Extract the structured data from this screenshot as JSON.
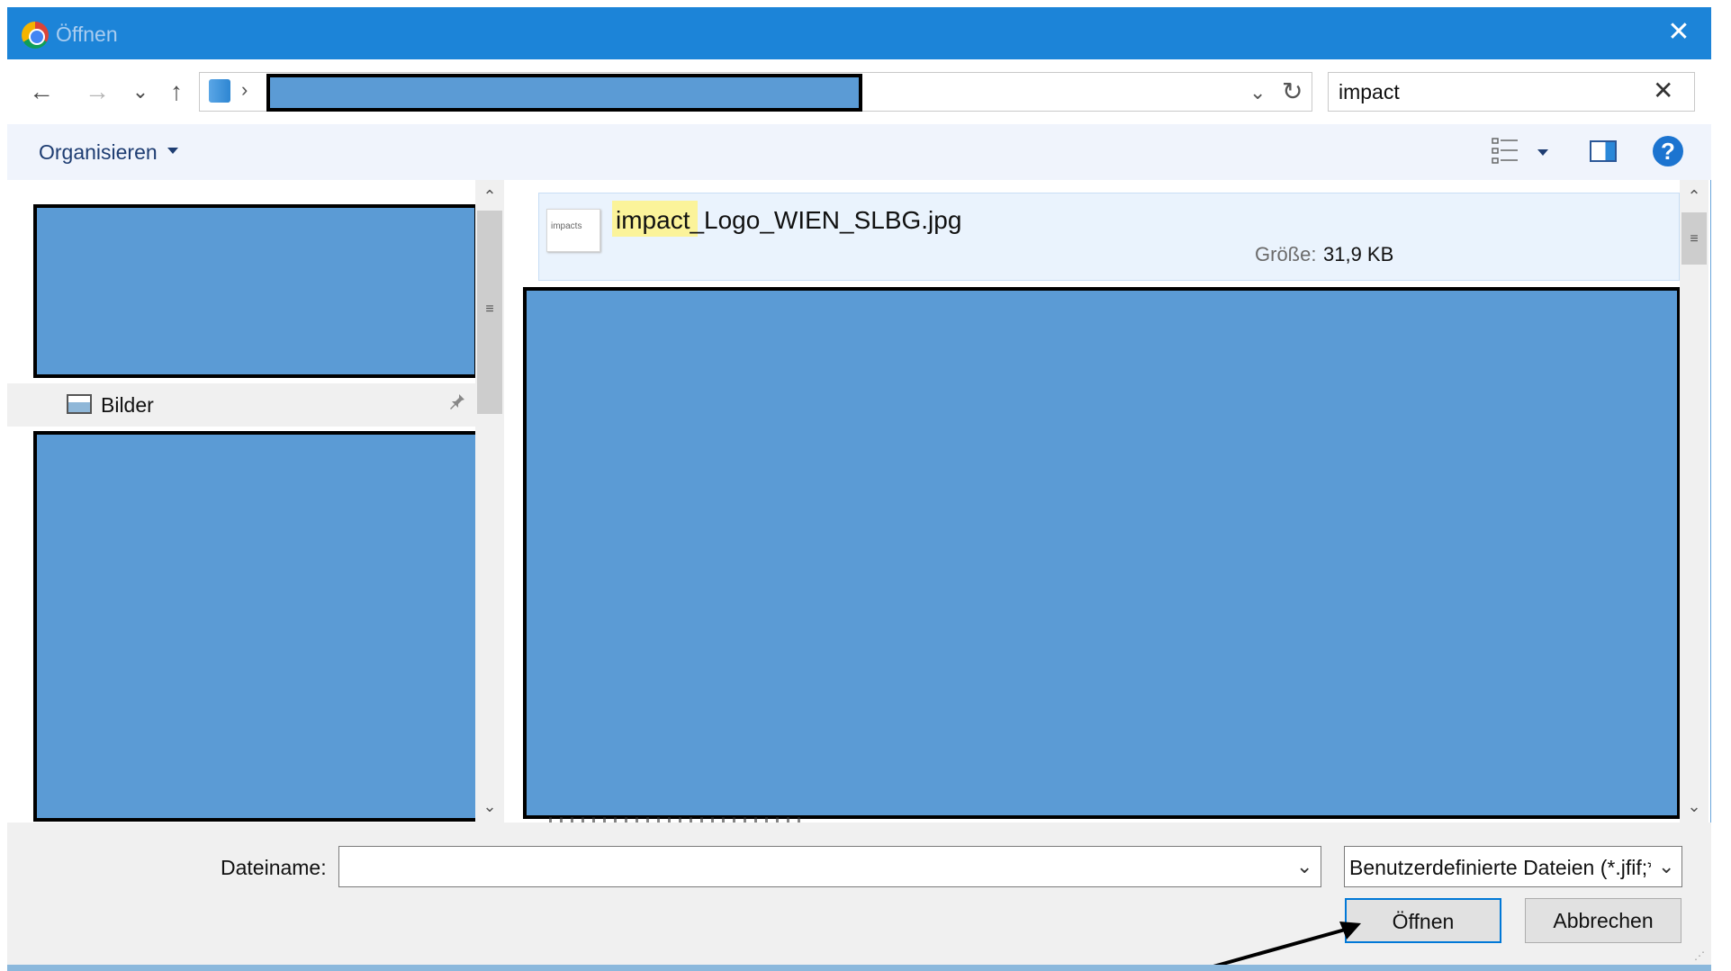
{
  "window": {
    "title": "Öffnen",
    "close_glyph": "✕"
  },
  "nav": {
    "back_glyph": "←",
    "forward_glyph": "→",
    "recent_glyph": "⌄",
    "up_glyph": "↑",
    "path_sep": "›",
    "address_dd_glyph": "⌄",
    "refresh_glyph": "↻"
  },
  "search": {
    "value": "impact",
    "clear_glyph": "✕"
  },
  "toolbar": {
    "organize_label": "Organisieren",
    "help_glyph": "?"
  },
  "sidebar": {
    "items": [
      {
        "label": "Bilder",
        "icon": "pictures-icon",
        "pinned": true
      }
    ],
    "pin_glyph": "📌"
  },
  "files": [
    {
      "name_highlight": "impact",
      "name_rest": "_Logo_WIEN_SLBG.jpg",
      "size_label": "Größe:",
      "size_value": "31,9 KB",
      "thumb_text": "impacts"
    }
  ],
  "scroll": {
    "up_glyph": "⌃",
    "down_glyph": "⌄",
    "grip_glyph": "≡"
  },
  "footer": {
    "filename_label": "Dateiname:",
    "filename_value": "",
    "filetype_value": "Benutzerdefinierte Dateien (*.jfif;*.pjpeg;*.jpeg;*.pjp;*.jpg;*.png)",
    "dd_glyph": "⌄",
    "open_label": "Öffnen",
    "cancel_label": "Abbrechen"
  },
  "colors": {
    "titlebar": "#1c84d8",
    "redaction": "#5b9bd5",
    "selection": "#eaf3fd",
    "highlight": "#fbf39a"
  }
}
